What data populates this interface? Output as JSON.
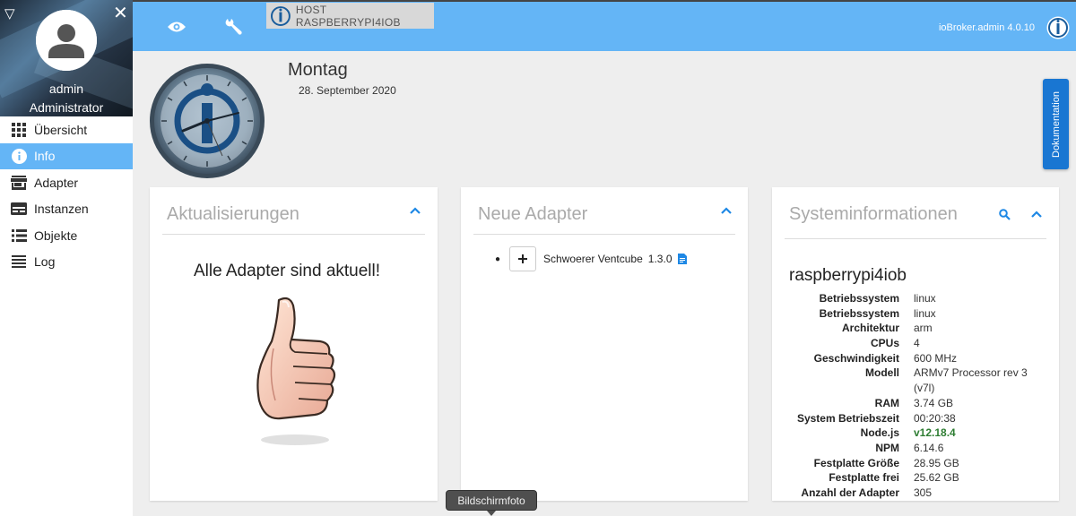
{
  "sidebar": {
    "user_name": "admin",
    "user_role": "Administrator",
    "items": [
      {
        "label": "Übersicht",
        "icon": "apps-grid-icon",
        "active": false
      },
      {
        "label": "Info",
        "icon": "info-icon",
        "active": true
      },
      {
        "label": "Adapter",
        "icon": "store-icon",
        "active": false
      },
      {
        "label": "Instanzen",
        "icon": "instances-icon",
        "active": false
      },
      {
        "label": "Objekte",
        "icon": "list-icon",
        "active": false
      },
      {
        "label": "Log",
        "icon": "log-lines-icon",
        "active": false
      }
    ]
  },
  "topbar": {
    "host_label": "HOST RASPBERRYPI4IOB",
    "version": "ioBroker.admin 4.0.10"
  },
  "header": {
    "day": "Montag",
    "date": "28. September 2020"
  },
  "doc_tab": "Dokumentation",
  "updates": {
    "title": "Aktualisierungen",
    "message": "Alle Adapter sind aktuell!"
  },
  "new_adapters": {
    "title": "Neue Adapter",
    "items": [
      {
        "name": "Schwoerer Ventcube",
        "version": "1.3.0"
      }
    ]
  },
  "sysinfo": {
    "title": "Systeminformationen",
    "host": "raspberrypi4iob",
    "rows": [
      {
        "key": "Betriebssystem",
        "value": "linux"
      },
      {
        "key": "Betriebssystem",
        "value": "linux"
      },
      {
        "key": "Architektur",
        "value": "arm"
      },
      {
        "key": "CPUs",
        "value": "4"
      },
      {
        "key": "Geschwindigkeit",
        "value": "600 MHz"
      },
      {
        "key": "Modell",
        "value": "ARMv7 Processor rev 3"
      },
      {
        "key": "",
        "value": "(v7l)"
      },
      {
        "key": "RAM",
        "value": "3.74 GB"
      },
      {
        "key": "System Betriebszeit",
        "value": "00:20:38"
      },
      {
        "key": "Node.js",
        "value": "v12.18.4"
      },
      {
        "key": "NPM",
        "value": "6.14.6"
      },
      {
        "key": "Festplatte Größe",
        "value": "28.95 GB"
      },
      {
        "key": "Festplatte frei",
        "value": "25.62 GB"
      },
      {
        "key": "Anzahl der Adapter",
        "value": "305"
      }
    ],
    "nodejs_color": "#2e7d32"
  },
  "tooltip": "Bildschirmfoto",
  "colors": {
    "accent": "#64b5f6",
    "doc_button": "#1976d2",
    "chevron": "#1e88e5"
  }
}
